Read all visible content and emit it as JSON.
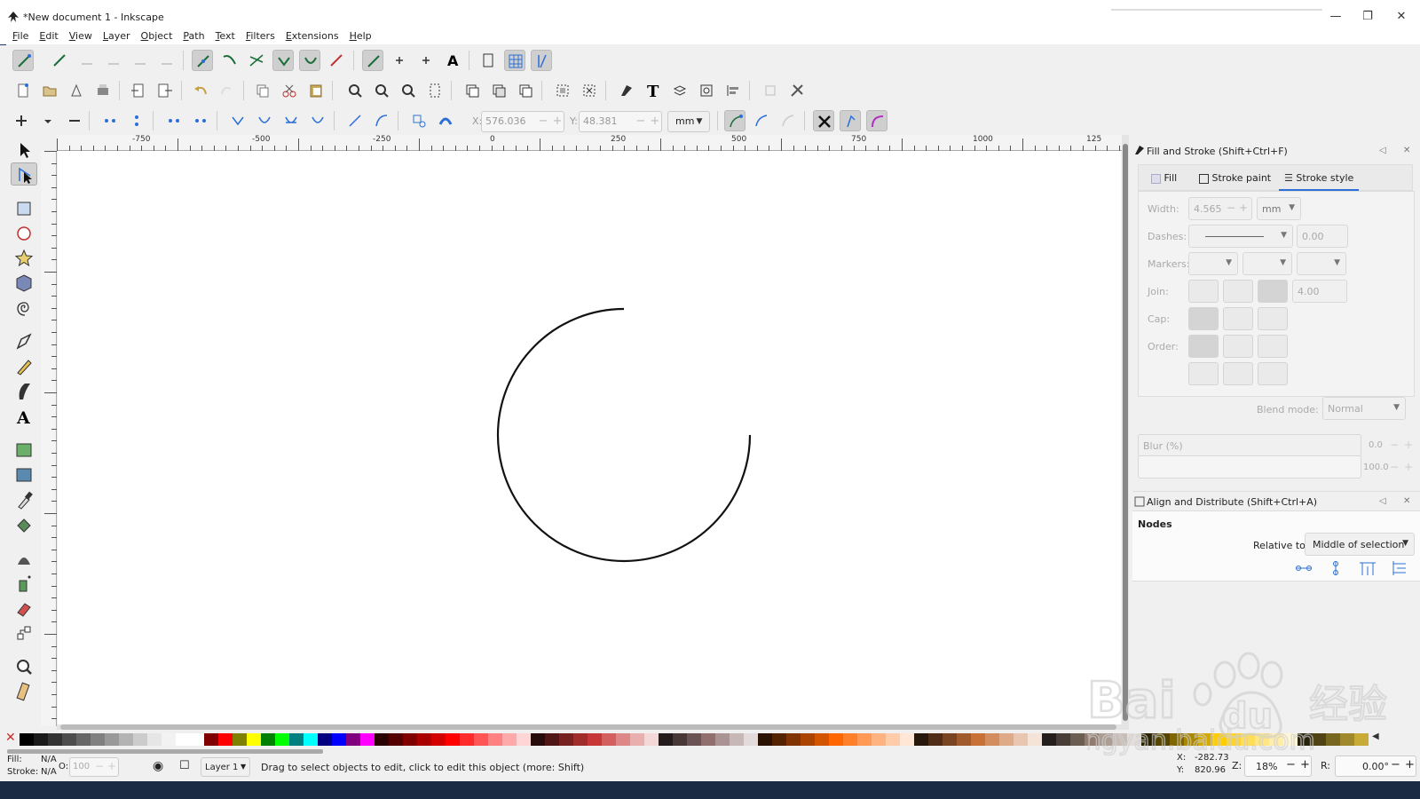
{
  "window": {
    "title": "*New document 1 - Inkscape"
  },
  "menu": [
    {
      "label": "File",
      "u": "F",
      "rest": "ile"
    },
    {
      "label": "Edit",
      "u": "E",
      "rest": "dit"
    },
    {
      "label": "View",
      "u": "V",
      "rest": "iew"
    },
    {
      "label": "Layer",
      "u": "L",
      "rest": "ayer"
    },
    {
      "label": "Object",
      "u": "O",
      "rest": "bject"
    },
    {
      "label": "Path",
      "u": "P",
      "rest": "ath"
    },
    {
      "label": "Text",
      "u": "T",
      "rest": "ext"
    },
    {
      "label": "Filters",
      "u": "F",
      "rest": "ilters"
    },
    {
      "label": "Extensions",
      "u": "E",
      "rest": "xtensions"
    },
    {
      "label": "Help",
      "u": "H",
      "rest": "elp"
    }
  ],
  "node_toolbar": {
    "x_label": "X:",
    "x_value": "576.036",
    "y_label": "Y:",
    "y_value": "48.381",
    "unit": "mm"
  },
  "ruler": {
    "h_labels": [
      "-750",
      "-500",
      "-250",
      "0",
      "250",
      "500",
      "750",
      "1000",
      "125"
    ]
  },
  "fill_stroke": {
    "title": "Fill and Stroke (Shift+Ctrl+F)",
    "tabs": [
      "Fill",
      "Stroke paint",
      "Stroke style"
    ],
    "active_tab": "Stroke style",
    "width_label": "Width:",
    "width_value": "4.565",
    "width_unit": "mm",
    "dashes_label": "Dashes:",
    "dashes_value": "0.00",
    "markers_label": "Markers:",
    "join_label": "Join:",
    "join_value": "4.00",
    "cap_label": "Cap:",
    "order_label": "Order:",
    "blend_label": "Blend mode:",
    "blend_value": "Normal",
    "blur_label": "Blur (%)",
    "blur_value": "0.0",
    "opacity_value": "100.0"
  },
  "align": {
    "title": "Align and Distribute (Shift+Ctrl+A)",
    "section": "Nodes",
    "relative_label": "Relative to:",
    "relative_value": "Middle of selection"
  },
  "status": {
    "fill_label": "Fill:",
    "fill_value": "N/A",
    "stroke_label": "Stroke:",
    "stroke_value": "N/A",
    "opacity_label": "O:",
    "opacity_value": "100",
    "layer": "Layer 1",
    "message": "Drag to select objects to edit, click to edit this object (more: Shift)",
    "cursor_x_label": "X:",
    "cursor_x": "-282.73",
    "cursor_y_label": "Y:",
    "cursor_y": "820.96",
    "zoom_label": "Z:",
    "zoom": "18%",
    "rotation_label": "R:",
    "rotation": "0.00°"
  },
  "watermark": {
    "brand": "Bai",
    "brand2": "du",
    "cn": "经验",
    "url": "jingyan.baidu.com"
  },
  "colors": {
    "accent": "#2b6fd6",
    "canvas": "#ffffff",
    "chrome": "#f0f0f0"
  }
}
